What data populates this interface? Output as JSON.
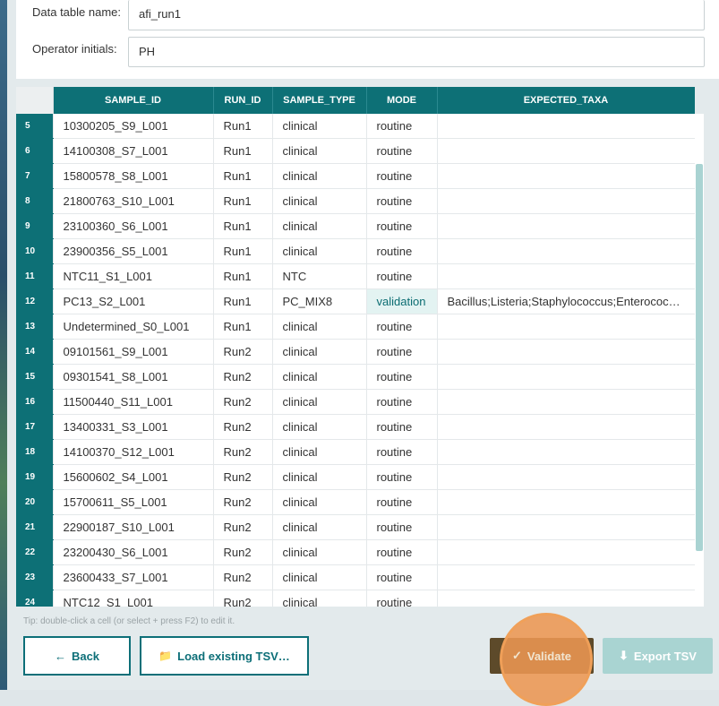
{
  "form": {
    "table_name_label": "Data table name:",
    "table_name_value": "afi_run1",
    "operator_label": "Operator initials:",
    "operator_value": "PH"
  },
  "table": {
    "columns": [
      "SAMPLE_ID",
      "RUN_ID",
      "SAMPLE_TYPE",
      "MODE",
      "EXPECTED_TAXA"
    ],
    "rows": [
      {
        "num": "5",
        "sample_id": "10300205_S9_L001",
        "run_id": "Run1",
        "sample_type": "clinical",
        "mode": "routine",
        "expected_taxa": ""
      },
      {
        "num": "6",
        "sample_id": "14100308_S7_L001",
        "run_id": "Run1",
        "sample_type": "clinical",
        "mode": "routine",
        "expected_taxa": ""
      },
      {
        "num": "7",
        "sample_id": "15800578_S8_L001",
        "run_id": "Run1",
        "sample_type": "clinical",
        "mode": "routine",
        "expected_taxa": ""
      },
      {
        "num": "8",
        "sample_id": "21800763_S10_L001",
        "run_id": "Run1",
        "sample_type": "clinical",
        "mode": "routine",
        "expected_taxa": ""
      },
      {
        "num": "9",
        "sample_id": "23100360_S6_L001",
        "run_id": "Run1",
        "sample_type": "clinical",
        "mode": "routine",
        "expected_taxa": ""
      },
      {
        "num": "10",
        "sample_id": "23900356_S5_L001",
        "run_id": "Run1",
        "sample_type": "clinical",
        "mode": "routine",
        "expected_taxa": ""
      },
      {
        "num": "11",
        "sample_id": "NTC11_S1_L001",
        "run_id": "Run1",
        "sample_type": "NTC",
        "mode": "routine",
        "expected_taxa": ""
      },
      {
        "num": "12",
        "sample_id": "PC13_S2_L001",
        "run_id": "Run1",
        "sample_type": "PC_MIX8",
        "mode": "validation",
        "expected_taxa": "Bacillus;Listeria;Staphylococcus;Enterococ…",
        "highlight_mode": true
      },
      {
        "num": "13",
        "sample_id": "Undetermined_S0_L001",
        "run_id": "Run1",
        "sample_type": "clinical",
        "mode": "routine",
        "expected_taxa": ""
      },
      {
        "num": "14",
        "sample_id": "09101561_S9_L001",
        "run_id": "Run2",
        "sample_type": "clinical",
        "mode": "routine",
        "expected_taxa": ""
      },
      {
        "num": "15",
        "sample_id": "09301541_S8_L001",
        "run_id": "Run2",
        "sample_type": "clinical",
        "mode": "routine",
        "expected_taxa": ""
      },
      {
        "num": "16",
        "sample_id": "11500440_S11_L001",
        "run_id": "Run2",
        "sample_type": "clinical",
        "mode": "routine",
        "expected_taxa": ""
      },
      {
        "num": "17",
        "sample_id": "13400331_S3_L001",
        "run_id": "Run2",
        "sample_type": "clinical",
        "mode": "routine",
        "expected_taxa": ""
      },
      {
        "num": "18",
        "sample_id": "14100370_S12_L001",
        "run_id": "Run2",
        "sample_type": "clinical",
        "mode": "routine",
        "expected_taxa": ""
      },
      {
        "num": "19",
        "sample_id": "15600602_S4_L001",
        "run_id": "Run2",
        "sample_type": "clinical",
        "mode": "routine",
        "expected_taxa": ""
      },
      {
        "num": "20",
        "sample_id": "15700611_S5_L001",
        "run_id": "Run2",
        "sample_type": "clinical",
        "mode": "routine",
        "expected_taxa": ""
      },
      {
        "num": "21",
        "sample_id": "22900187_S10_L001",
        "run_id": "Run2",
        "sample_type": "clinical",
        "mode": "routine",
        "expected_taxa": ""
      },
      {
        "num": "22",
        "sample_id": "23200430_S6_L001",
        "run_id": "Run2",
        "sample_type": "clinical",
        "mode": "routine",
        "expected_taxa": ""
      },
      {
        "num": "23",
        "sample_id": "23600433_S7_L001",
        "run_id": "Run2",
        "sample_type": "clinical",
        "mode": "routine",
        "expected_taxa": ""
      },
      {
        "num": "24",
        "sample_id": "NTC12_S1_L001",
        "run_id": "Run2",
        "sample_type": "clinical",
        "mode": "routine",
        "expected_taxa": ""
      }
    ]
  },
  "tip": "Tip: double-click a cell (or select + press F2) to edit it.",
  "buttons": {
    "back": "Back",
    "back_icon": "←",
    "load": "Load existing TSV…",
    "load_icon": "📁",
    "validate": "Validate",
    "validate_icon": "✓",
    "export": "Export TSV",
    "export_icon": "⬇"
  },
  "colors": {
    "header_teal": "#0d7076",
    "accent_orange": "#ec9652",
    "validate_brown": "#5d4a2a",
    "export_disabled": "#a9d4d2"
  }
}
